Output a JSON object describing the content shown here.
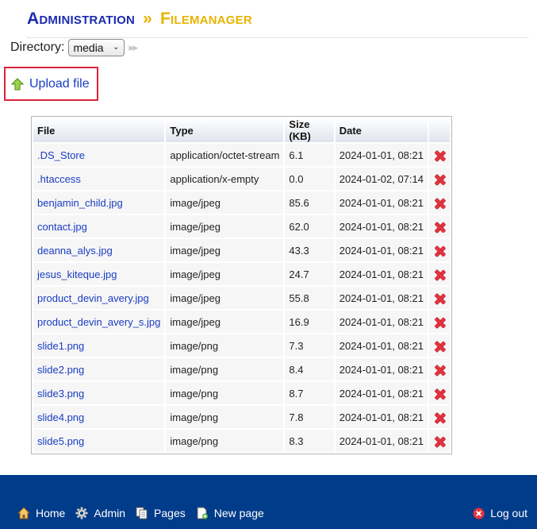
{
  "header": {
    "breadcrumb_root": "Administration",
    "breadcrumb_sep": "»",
    "breadcrumb_current": "Filemanager"
  },
  "directory": {
    "label": "Directory:",
    "selected": "media",
    "go_icon": "double-arrow-right-icon"
  },
  "upload": {
    "label": "Upload file",
    "icon": "upload-arrow-icon"
  },
  "table": {
    "columns": [
      "File",
      "Type",
      "Size (KB)",
      "Date",
      ""
    ],
    "rows": [
      {
        "name": ".DS_Store",
        "type": "application/octet-stream",
        "size": "6.1",
        "date": "2024-01-01, 08:21"
      },
      {
        "name": ".htaccess",
        "type": "application/x-empty",
        "size": "0.0",
        "date": "2024-01-02, 07:14"
      },
      {
        "name": "benjamin_child.jpg",
        "type": "image/jpeg",
        "size": "85.6",
        "date": "2024-01-01, 08:21"
      },
      {
        "name": "contact.jpg",
        "type": "image/jpeg",
        "size": "62.0",
        "date": "2024-01-01, 08:21"
      },
      {
        "name": "deanna_alys.jpg",
        "type": "image/jpeg",
        "size": "43.3",
        "date": "2024-01-01, 08:21"
      },
      {
        "name": "jesus_kiteque.jpg",
        "type": "image/jpeg",
        "size": "24.7",
        "date": "2024-01-01, 08:21"
      },
      {
        "name": "product_devin_avery.jpg",
        "type": "image/jpeg",
        "size": "55.8",
        "date": "2024-01-01, 08:21"
      },
      {
        "name": "product_devin_avery_s.jpg",
        "type": "image/jpeg",
        "size": "16.9",
        "date": "2024-01-01, 08:21"
      },
      {
        "name": "slide1.png",
        "type": "image/png",
        "size": "7.3",
        "date": "2024-01-01, 08:21"
      },
      {
        "name": "slide2.png",
        "type": "image/png",
        "size": "8.4",
        "date": "2024-01-01, 08:21"
      },
      {
        "name": "slide3.png",
        "type": "image/png",
        "size": "8.7",
        "date": "2024-01-01, 08:21"
      },
      {
        "name": "slide4.png",
        "type": "image/png",
        "size": "7.8",
        "date": "2024-01-01, 08:21"
      },
      {
        "name": "slide5.png",
        "type": "image/png",
        "size": "8.3",
        "date": "2024-01-01, 08:21"
      }
    ],
    "delete_icon": "delete-x-icon"
  },
  "footer": {
    "nav": [
      {
        "label": "Home",
        "icon": "home-icon"
      },
      {
        "label": "Admin",
        "icon": "gear-icon"
      },
      {
        "label": "Pages",
        "icon": "pages-icon"
      },
      {
        "label": "New page",
        "icon": "new-page-icon"
      }
    ],
    "logout": {
      "label": "Log out",
      "icon": "logout-icon"
    }
  },
  "colors": {
    "title_blue": "#1a2bb0",
    "title_gold": "#e8b400",
    "link_blue": "#1a3cc4",
    "highlight_red": "#d9243a",
    "footer_blue": "#013c8a",
    "delete_red": "#e53340"
  }
}
